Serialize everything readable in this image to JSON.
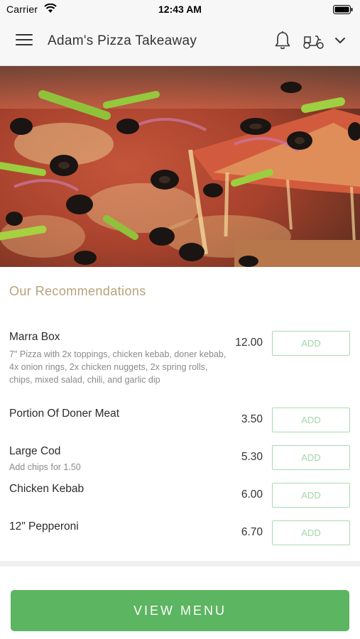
{
  "status_bar": {
    "carrier": "Carrier",
    "time": "12:43 AM"
  },
  "header": {
    "title": "Adam's Pizza Takeaway"
  },
  "recommendations": {
    "title": "Our Recommendations",
    "add_label": "ADD",
    "items": [
      {
        "name": "Marra Box",
        "description": "7\" Pizza with 2x toppings, chicken kebab, doner kebab, 4x onion rings, 2x chicken nuggets, 2x spring rolls, chips, mixed salad, chili, and garlic dip",
        "price": "12.00"
      },
      {
        "name": "Portion Of Doner Meat",
        "description": "",
        "price": "3.50"
      },
      {
        "name": "Large Cod",
        "description": "Add chips for 1.50",
        "price": "5.30"
      },
      {
        "name": "Chicken Kebab",
        "description": "",
        "price": "6.00"
      },
      {
        "name": "12\" Pepperoni",
        "description": "",
        "price": "6.70"
      }
    ]
  },
  "footer": {
    "view_menu_label": "VIEW MENU"
  },
  "colors": {
    "accent_green": "#5cb560",
    "section_title": "#b7a27a",
    "add_border": "#a8dcae"
  }
}
